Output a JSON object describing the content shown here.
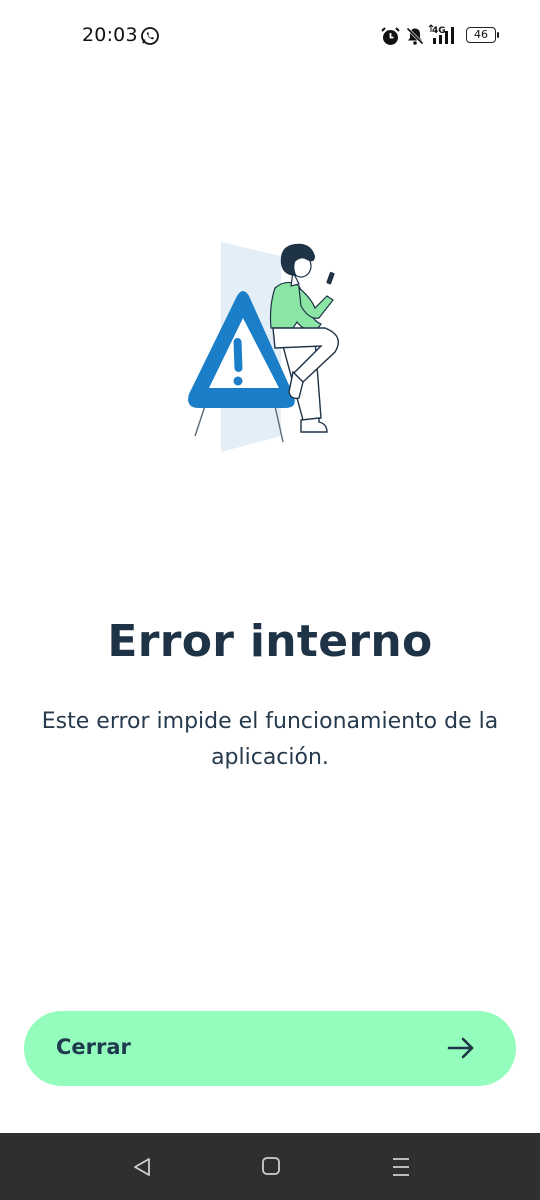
{
  "status_bar": {
    "time": "20:03",
    "signal_label": "4G",
    "battery": "46",
    "icons": [
      "whatsapp-icon",
      "alarm-icon",
      "bell-muted-icon",
      "signal-icon",
      "battery-icon"
    ]
  },
  "error": {
    "title": "Error interno",
    "message": "Este error impide el funcionamiento de la aplicación."
  },
  "button": {
    "label": "Cerrar",
    "icon": "arrow-right-icon"
  },
  "nav_bar": {
    "icons": [
      "back-icon",
      "home-icon",
      "menu-icon"
    ]
  },
  "colors": {
    "button_bg": "#94fcbd",
    "title": "#1f3347",
    "warning_blue": "#1a7ec8",
    "nav_bg": "#2f2f2f"
  }
}
